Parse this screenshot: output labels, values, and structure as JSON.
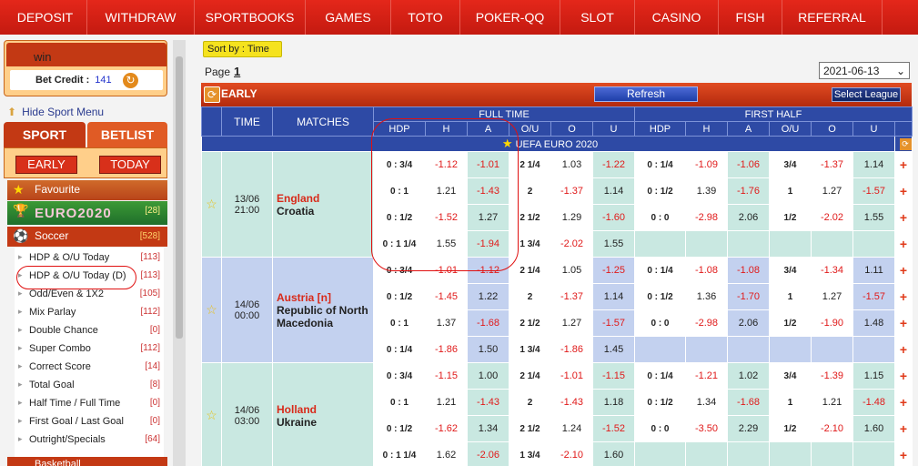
{
  "nav": [
    "DEPOSIT",
    "WITHDRAW",
    "SPORTBOOKS",
    "GAMES",
    "TOTO",
    "POKER-QQ",
    "SLOT",
    "CASINO",
    "FISH",
    "REFERRAL"
  ],
  "user": {
    "name": "win",
    "credit_label": "Bet Credit :",
    "credit": "141"
  },
  "hide_menu": "Hide Sport Menu",
  "tabs": {
    "sport": "SPORT",
    "betlist": "BETLIST"
  },
  "modes": {
    "early": "EARLY",
    "today": "TODAY"
  },
  "favourite": "Favourite",
  "euro": {
    "label": "EURO2020",
    "count": "[28]"
  },
  "soccer": {
    "label": "Soccer",
    "count": "[528]"
  },
  "soccer_items": [
    {
      "label": "HDP & O/U Today",
      "count": "[113]"
    },
    {
      "label": "HDP & O/U Today (D)",
      "count": "[113]"
    },
    {
      "label": "Odd/Even & 1X2",
      "count": "[105]"
    },
    {
      "label": "Mix Parlay",
      "count": "[112]"
    },
    {
      "label": "Double Chance",
      "count": "[0]"
    },
    {
      "label": "Super Combo",
      "count": "[112]"
    },
    {
      "label": "Correct Score",
      "count": "[14]"
    },
    {
      "label": "Total Goal",
      "count": "[8]"
    },
    {
      "label": "Half Time / Full Time",
      "count": "[0]"
    },
    {
      "label": "First Goal / Last Goal",
      "count": "[0]"
    },
    {
      "label": "Outright/Specials",
      "count": "[64]"
    }
  ],
  "basketball": "Basketball",
  "sort": {
    "label": "Sort by :",
    "value": "Time"
  },
  "page": {
    "label": "Page",
    "num": "1"
  },
  "date": "2021-06-13",
  "section": {
    "title": "EARLY",
    "refresh": "Refresh",
    "select_league": "Select League"
  },
  "headers": {
    "time": "TIME",
    "matches": "MATCHES",
    "full_time": "FULL TIME",
    "first_half": "FIRST HALF",
    "cols": [
      "HDP",
      "H",
      "A",
      "O/U",
      "O",
      "U",
      "HDP",
      "H",
      "A",
      "O/U",
      "O",
      "U"
    ]
  },
  "league": "UEFA EURO 2020",
  "matches": [
    {
      "date": "13/06",
      "time": "21:00",
      "home": "England",
      "away": "Croatia",
      "lines": [
        [
          "0 : 3/4",
          "-1.12",
          "-1.01",
          "2 1/4",
          "1.03",
          "-1.22",
          "0 : 1/4",
          "-1.09",
          "-1.06",
          "3/4",
          "-1.37",
          "1.14"
        ],
        [
          "0 : 1",
          "1.21",
          "-1.43",
          "2",
          "-1.37",
          "1.14",
          "0 : 1/2",
          "1.39",
          "-1.76",
          "1",
          "1.27",
          "-1.57"
        ],
        [
          "0 : 1/2",
          "-1.52",
          "1.27",
          "2 1/2",
          "1.29",
          "-1.60",
          "0 : 0",
          "-2.98",
          "2.06",
          "1/2",
          "-2.02",
          "1.55"
        ],
        [
          "0 : 1 1/4",
          "1.55",
          "-1.94",
          "1 3/4",
          "-2.02",
          "1.55",
          "",
          "",
          "",
          "",
          "",
          ""
        ]
      ]
    },
    {
      "date": "14/06",
      "time": "00:00",
      "home": "Austria [n]",
      "away": "Republic of North Macedonia",
      "lines": [
        [
          "0 : 3/4",
          "-1.01",
          "-1.12",
          "2 1/4",
          "1.05",
          "-1.25",
          "0 : 1/4",
          "-1.08",
          "-1.08",
          "3/4",
          "-1.34",
          "1.11"
        ],
        [
          "0 : 1/2",
          "-1.45",
          "1.22",
          "2",
          "-1.37",
          "1.14",
          "0 : 1/2",
          "1.36",
          "-1.70",
          "1",
          "1.27",
          "-1.57"
        ],
        [
          "0 : 1",
          "1.37",
          "-1.68",
          "2 1/2",
          "1.27",
          "-1.57",
          "0 : 0",
          "-2.98",
          "2.06",
          "1/2",
          "-1.90",
          "1.48"
        ],
        [
          "0 : 1/4",
          "-1.86",
          "1.50",
          "1 3/4",
          "-1.86",
          "1.45",
          "",
          "",
          "",
          "",
          "",
          ""
        ]
      ]
    },
    {
      "date": "14/06",
      "time": "03:00",
      "home": "Holland",
      "away": "Ukraine",
      "lines": [
        [
          "0 : 3/4",
          "-1.15",
          "1.00",
          "2 1/4",
          "-1.01",
          "-1.15",
          "0 : 1/4",
          "-1.21",
          "1.02",
          "3/4",
          "-1.39",
          "1.15"
        ],
        [
          "0 : 1",
          "1.21",
          "-1.43",
          "2",
          "-1.43",
          "1.18",
          "0 : 1/2",
          "1.34",
          "-1.68",
          "1",
          "1.21",
          "-1.48"
        ],
        [
          "0 : 1/2",
          "-1.62",
          "1.34",
          "2 1/2",
          "1.24",
          "-1.52",
          "0 : 0",
          "-3.50",
          "2.29",
          "1/2",
          "-2.10",
          "1.60"
        ],
        [
          "0 : 1 1/4",
          "1.62",
          "-2.06",
          "1 3/4",
          "-2.10",
          "1.60",
          "",
          "",
          "",
          "",
          "",
          ""
        ]
      ]
    }
  ]
}
